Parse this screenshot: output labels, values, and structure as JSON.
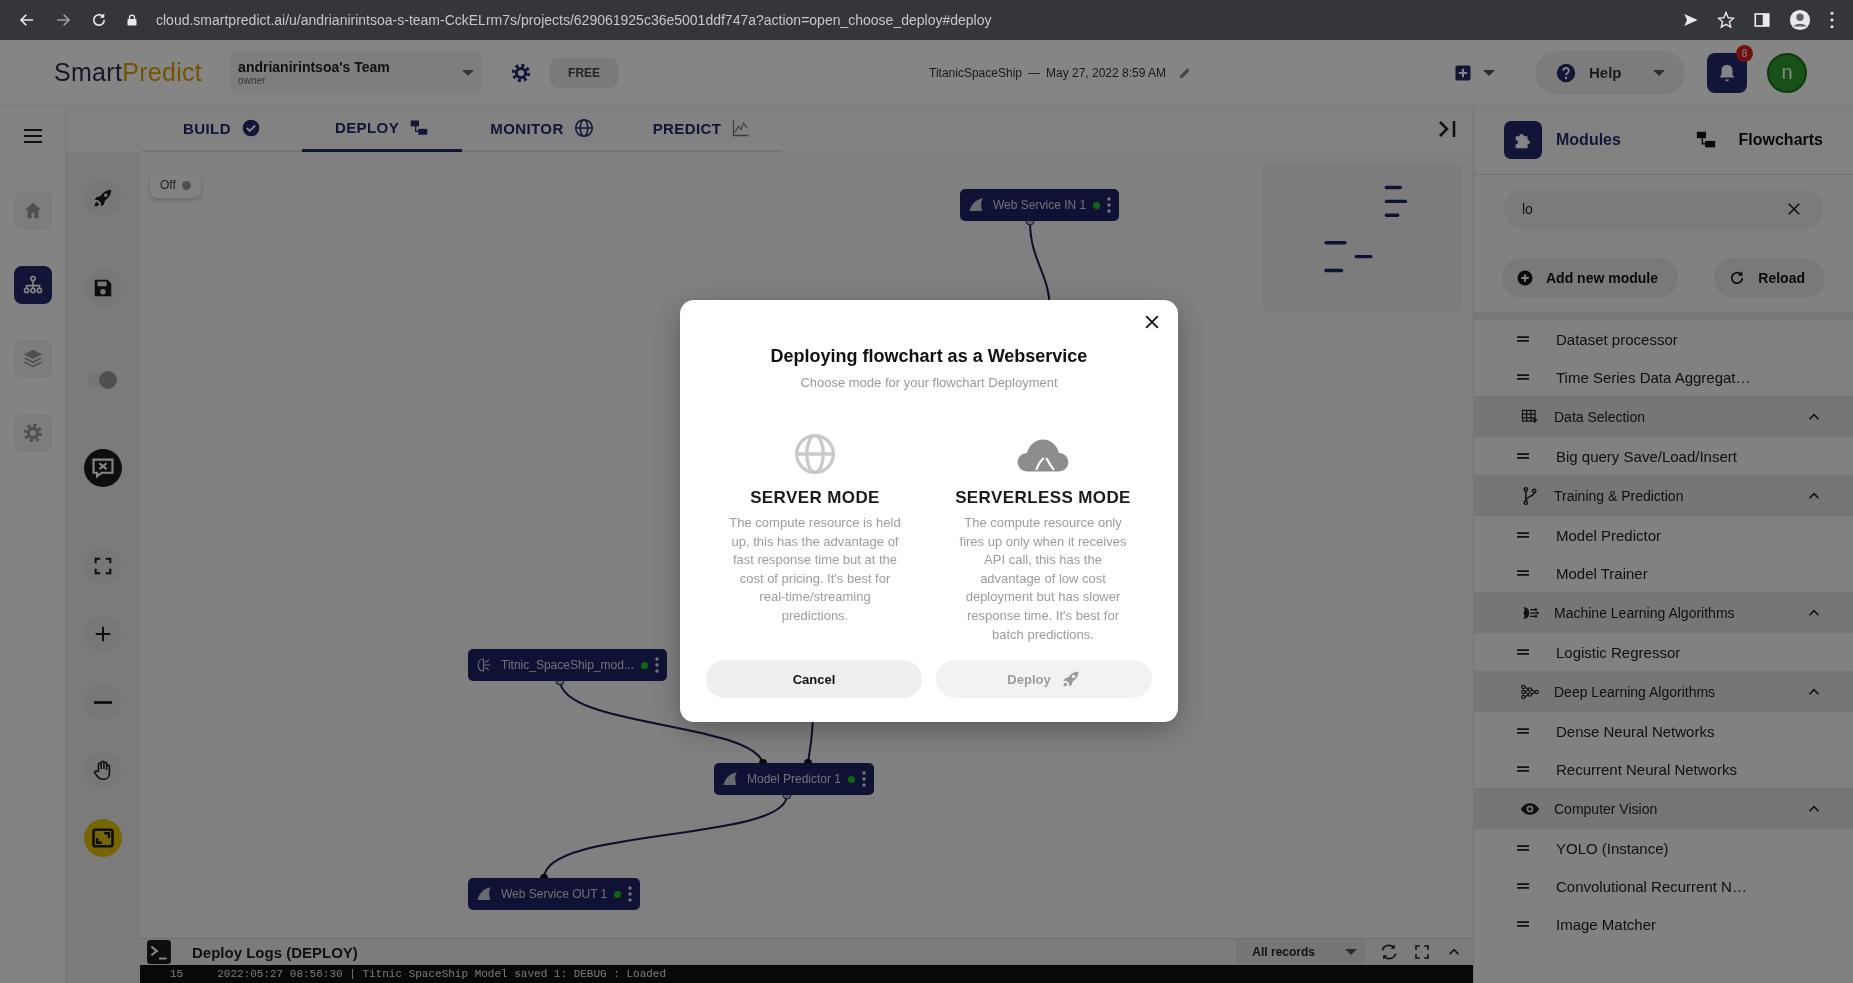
{
  "browser": {
    "url": "cloud.smartpredict.ai/u/andrianirintsoa-s-team-CckELrm7s/projects/629061925c36e5001ddf747a?action=open_choose_deploy#deploy"
  },
  "header": {
    "logo": {
      "first": "Smart",
      "second": "Predict"
    },
    "team": {
      "name": "andrianirintsoa's Team",
      "role": "owner"
    },
    "plan": "FREE",
    "project": "TitanicSpaceShip",
    "separator": "—",
    "date": "May 27, 2022 8:59 AM",
    "help": "Help",
    "notifications": "8",
    "avatar": "n"
  },
  "tabs": [
    {
      "label": "BUILD",
      "selected": false
    },
    {
      "label": "DEPLOY",
      "selected": true
    },
    {
      "label": "MONITOR",
      "selected": false
    },
    {
      "label": "PREDICT",
      "selected": false
    }
  ],
  "canvas": {
    "toggle": {
      "label": "Off",
      "on": false
    },
    "nodes": [
      {
        "label": "Web Service IN 1",
        "kind": "module"
      },
      {
        "label": "Titnic_SpaceShip_mod...",
        "kind": "model"
      },
      {
        "label": "Model Predictor 1",
        "kind": "module"
      },
      {
        "label": "Web Service OUT 1",
        "kind": "module"
      }
    ]
  },
  "logs": {
    "title": "Deploy Logs (DEPLOY)",
    "filter": "All records",
    "lines": [
      {
        "number": "15",
        "text": "2022:05:27 08:56:30 | Titnic SpaceShip Model saved 1: DEBUG : Loaded"
      }
    ]
  },
  "panel": {
    "tabs": [
      {
        "label": "Modules",
        "selected": true
      },
      {
        "label": "Flowcharts",
        "selected": false
      }
    ],
    "search": {
      "value": "lo"
    },
    "actions": [
      "Add new module",
      "Reload"
    ],
    "leading_items": [
      "Dataset processor",
      "Time Series Data Aggregat…"
    ],
    "groups": [
      {
        "title": "Data Selection",
        "expanded": true,
        "items": [
          "Big query Save/Load/Insert"
        ]
      },
      {
        "title": "Training & Prediction",
        "expanded": true,
        "items": [
          "Model Predictor",
          "Model Trainer"
        ]
      },
      {
        "title": "Machine Learning Algorithms",
        "expanded": true,
        "items": [
          "Logistic Regressor"
        ]
      },
      {
        "title": "Deep Learning Algorithms",
        "expanded": true,
        "items": [
          "Dense Neural Networks",
          "Recurrent Neural Networks"
        ]
      },
      {
        "title": "Computer Vision",
        "expanded": true,
        "items": [
          "YOLO (Instance)",
          "Convolutional Recurrent N…",
          "Image Matcher"
        ]
      }
    ]
  },
  "modal": {
    "title": "Deploying flowchart as a Webservice",
    "subtitle": "Choose mode for your flowchart Deployment",
    "modes": [
      {
        "title": "SERVER MODE",
        "description": "The compute resource is held up, this has the advantage of fast response time but at the cost of pricing. It's best for real-time/streaming predictions."
      },
      {
        "title": "SERVERLESS MODE",
        "description": "The compute resource only fires up only when it receives API call, this has the advantage of low cost deployment but has slower response time. It's best for batch predictions."
      }
    ],
    "buttons": [
      {
        "label": "Cancel",
        "disabled": false
      },
      {
        "label": "Deploy",
        "disabled": true
      }
    ]
  }
}
